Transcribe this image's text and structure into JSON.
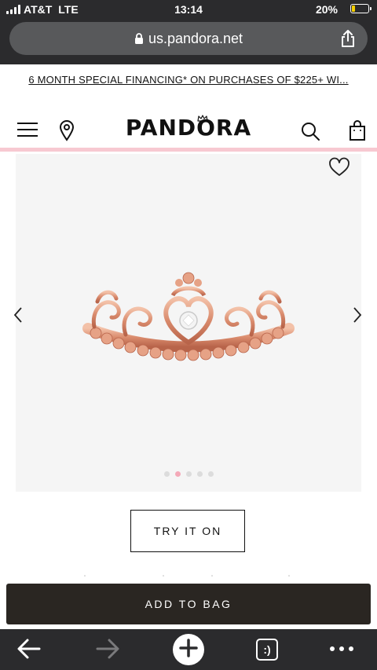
{
  "status_bar": {
    "carrier": "AT&T",
    "network": "LTE",
    "time": "13:14",
    "battery": "20%",
    "battery_level": 0.2,
    "battery_color": "#f5d000"
  },
  "browser": {
    "url": "us.pandora.net",
    "icons": [
      "lock-icon",
      "share-icon",
      "back-icon",
      "forward-icon",
      "plus-icon",
      "tabs-icon",
      "more-icon"
    ],
    "tabs_glyph": ":)"
  },
  "promo": {
    "text": "6 MONTH SPECIAL FINANCING* ON PURCHASES OF $225+ WI..."
  },
  "header": {
    "logo": "PANDORA",
    "accent_color": "#f7c9d1",
    "icons": [
      "menu-icon",
      "location-pin-icon",
      "search-icon",
      "shopping-bag-icon"
    ]
  },
  "product": {
    "image": "rose-gold-princess-tiara-ring",
    "carousel": {
      "count": 5,
      "active_index": 1
    },
    "try_on_label": "TRY IT ON",
    "add_to_bag_label": "ADD TO BAG"
  },
  "colors": {
    "chrome": "#2b2b2d",
    "add_to_bag": "#2a2622",
    "active_dot": "#f4a9b8"
  }
}
